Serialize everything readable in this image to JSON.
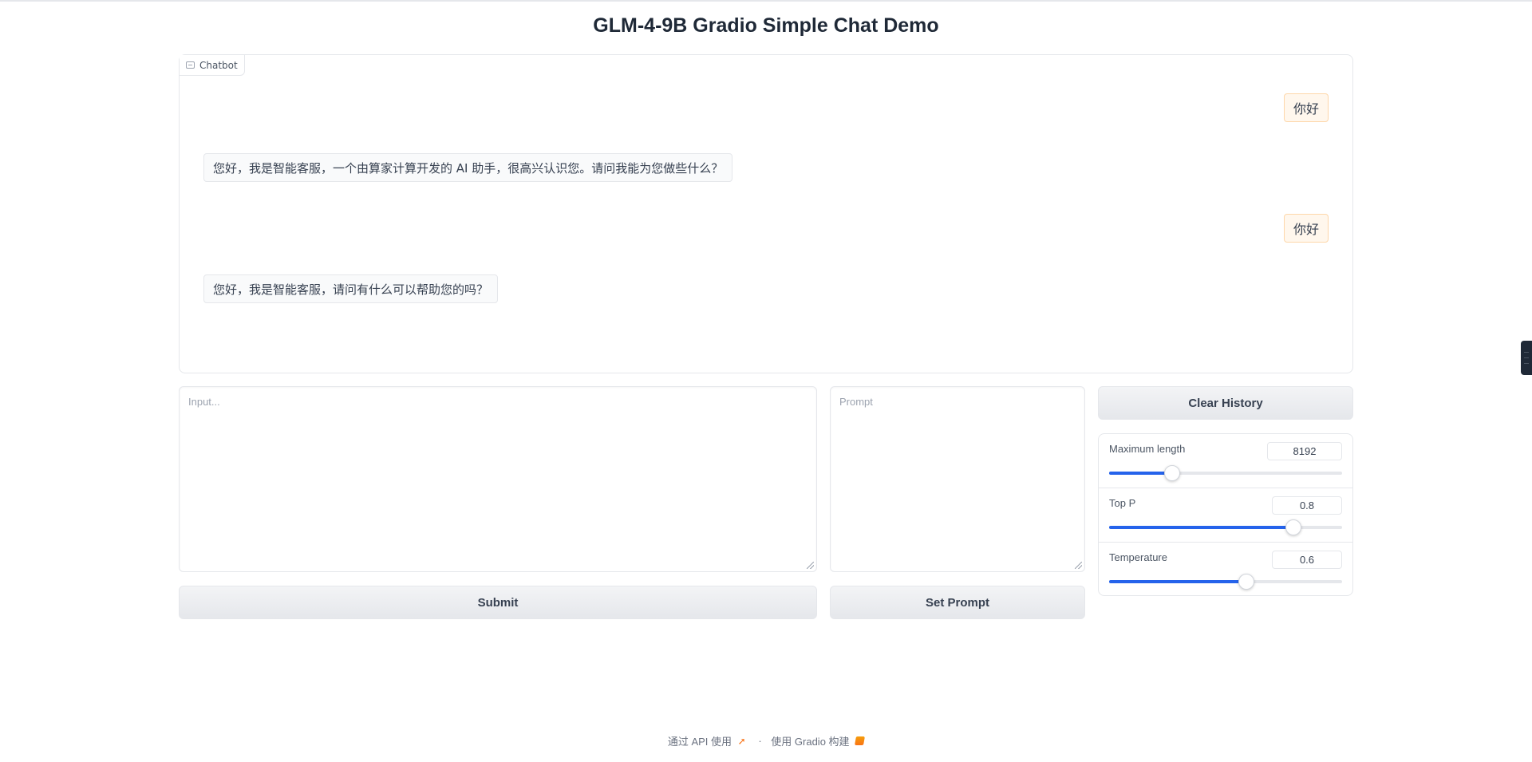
{
  "title": "GLM-4-9B Gradio Simple Chat Demo",
  "chatbot": {
    "label": "Chatbot",
    "messages": [
      {
        "role": "user",
        "text": "你好"
      },
      {
        "role": "assistant",
        "text": "您好，我是智能客服，一个由算家计算开发的 AI 助手，很高兴认识您。请问我能为您做些什么？"
      },
      {
        "role": "user",
        "text": "你好"
      },
      {
        "role": "assistant",
        "text": "您好，我是智能客服，请问有什么可以帮助您的吗？"
      }
    ]
  },
  "input": {
    "placeholder": "Input...",
    "value": ""
  },
  "prompt": {
    "placeholder": "Prompt",
    "value": ""
  },
  "buttons": {
    "submit": "Submit",
    "set_prompt": "Set Prompt",
    "clear_history": "Clear History"
  },
  "sliders": [
    {
      "label": "Maximum length",
      "value": "8192",
      "fraction": 0.27
    },
    {
      "label": "Top P",
      "value": "0.8",
      "fraction": 0.79
    },
    {
      "label": "Temperature",
      "value": "0.6",
      "fraction": 0.59
    }
  ],
  "colors": {
    "accent": "#2563eb",
    "user_bubble": "#fff7ed",
    "user_bubble_border": "#fed7aa"
  },
  "footer": {
    "api_text": "通过 API 使用",
    "separator": "·",
    "built_with": "使用 Gradio 构建"
  }
}
